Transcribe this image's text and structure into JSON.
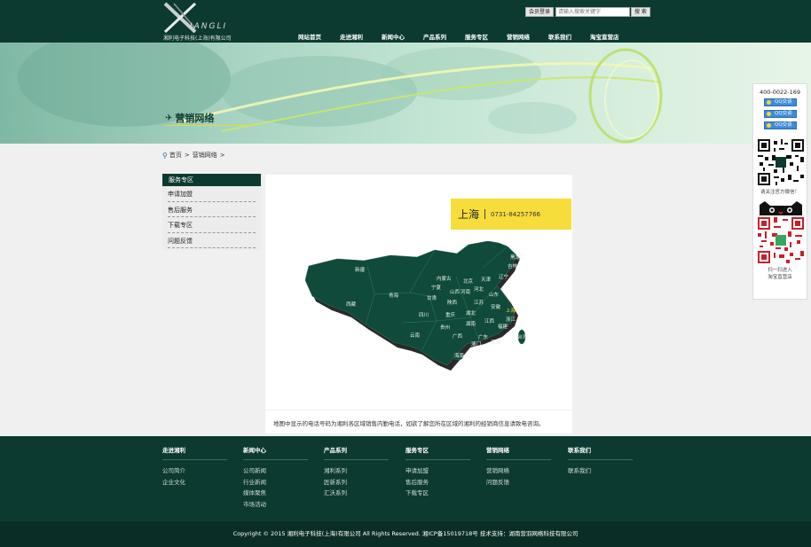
{
  "header": {
    "logo_word": "IANGLI",
    "logo_company": "湘利电子科技(上海)有限公司",
    "login_label": "会员登录",
    "search_placeholder": "请输入搜索关键字",
    "search_label": "搜 索",
    "nav": [
      "网站首页",
      "走进湘利",
      "新闻中心",
      "产品系列",
      "服务专区",
      "营销网络",
      "联系我们",
      "淘宝直营店"
    ]
  },
  "banner": {
    "title": "营销网络",
    "icon": "paper-plane-icon"
  },
  "breadcrumb": {
    "home": "首页",
    "sep": ">",
    "current": "营销网络"
  },
  "sidebar": {
    "title": "服务专区",
    "items": [
      "申请加盟",
      "售后服务",
      "下载专区",
      "问题反馈"
    ]
  },
  "content": {
    "phone_city": "上海",
    "phone_number": "0731-84257766",
    "map_labels": {
      "xinjiang": "新疆",
      "xizang": "西藏",
      "qinghai": "青海",
      "gansu": "甘肃",
      "neimenggu": "内蒙古",
      "ningxia": "宁夏",
      "shanxi2": "陕西",
      "shanxi": "山西",
      "henan": "河南",
      "hebei": "河北",
      "beijing": "北京",
      "tianjin": "天津",
      "liaoning": "辽宁",
      "jilin": "吉林",
      "heilongjiang": "黑龙江",
      "shandong": "山东",
      "jiangsu": "江苏",
      "anhui": "安徽",
      "shanghai": "上海",
      "zhejiang": "浙江",
      "sichuan": "四川",
      "chongqing": "重庆",
      "hubei": "湖北",
      "jiangxi": "江西",
      "fujian": "福建",
      "taiwan": "台湾",
      "hunan": "湖南",
      "guizhou": "贵州",
      "yunnan": "云南",
      "guangxi": "广西",
      "guangdong": "广东",
      "aomen": "澳门",
      "xianggang": "香港",
      "hainan": "海南"
    },
    "note": "地图中显示的电话号码为湘利各区域销售内勤电话，如欲了解您所在区域的湘利的经销商信息请致电咨询。"
  },
  "float_panel": {
    "phone": "400-0022-169",
    "qq_buttons": [
      "QQ交谈",
      "QQ交谈",
      "QQ交谈"
    ],
    "wechat_text": "请关注官方微信！",
    "taobao_text_1": "扫一扫进入",
    "taobao_text_2": "淘宝直营店"
  },
  "footer": {
    "columns": [
      {
        "title": "走进湘利",
        "links": [
          "公司简介",
          "企业文化"
        ]
      },
      {
        "title": "新闻中心",
        "links": [
          "公司新闻",
          "行业新闻",
          "媒体聚焦",
          "市场活动"
        ]
      },
      {
        "title": "产品系列",
        "links": [
          "湘利系列",
          "匠新系列",
          "汇沃系列"
        ]
      },
      {
        "title": "服务专区",
        "links": [
          "申请加盟",
          "售后服务",
          "下载专区"
        ]
      },
      {
        "title": "营销网络",
        "links": [
          "营销网络",
          "问题反馈"
        ]
      },
      {
        "title": "联系我们",
        "links": [
          "联系我们"
        ]
      }
    ],
    "copyright": "Copyright © 2015 湘利电子科技(上海)有限公司 All Rights Reserved. 湘ICP备15019718号 技术支持：湖南营羽网络科技有限公司"
  },
  "colors": {
    "brand_dark": "#0c3a30",
    "accent_yellow": "#f7dd3b",
    "map_green": "#0f4a3a"
  }
}
